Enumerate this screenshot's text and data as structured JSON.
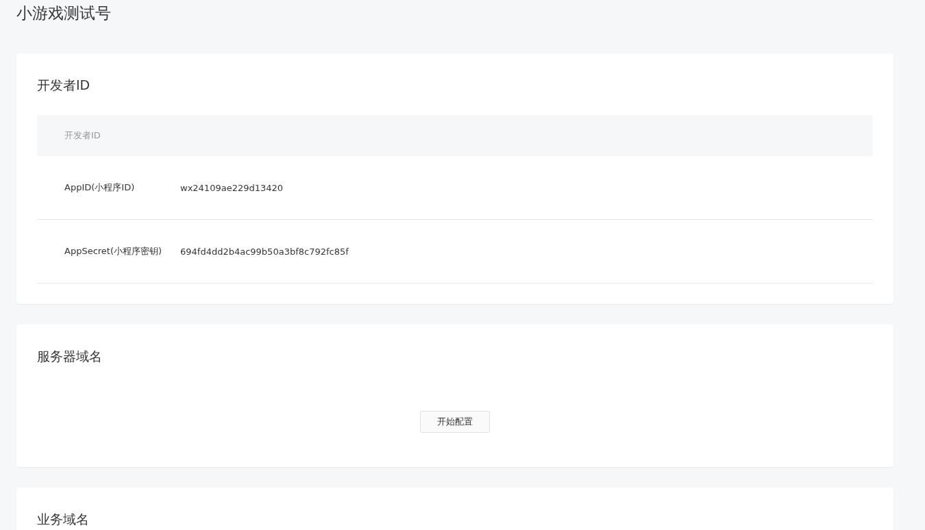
{
  "page_title": "小游戏测试号",
  "sections": [
    {
      "kind": "table",
      "title": "开发者ID",
      "table": {
        "columns": [
          "开发者ID"
        ],
        "rows": [
          {
            "label": "AppID(小程序ID)",
            "value": "wx24109ae229d13420"
          },
          {
            "label": "AppSecret(小程序密钥)",
            "value": "694fd4dd2b4ac99b50a3bf8c792fc85f"
          }
        ]
      }
    },
    {
      "kind": "action",
      "title": "服务器域名",
      "button": "开始配置"
    },
    {
      "kind": "empty",
      "title": "业务域名"
    }
  ]
}
